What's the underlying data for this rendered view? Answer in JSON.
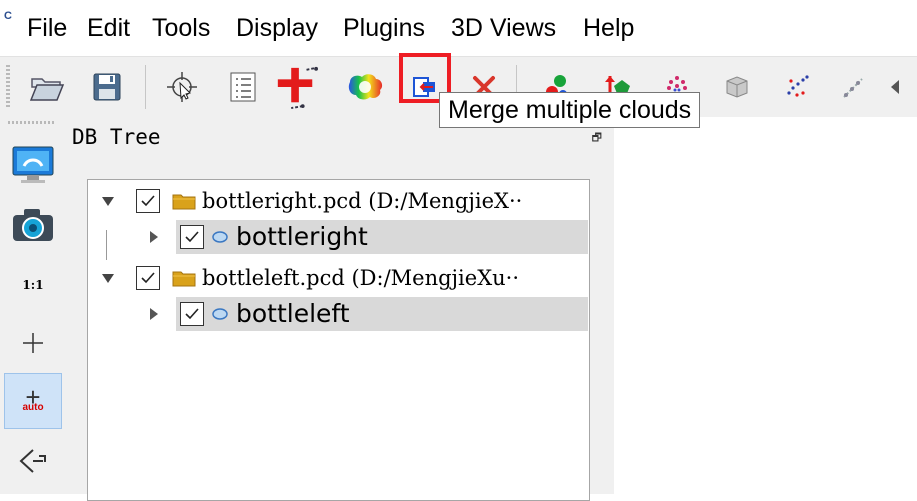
{
  "menu": {
    "items": [
      "File",
      "Edit",
      "Tools",
      "Display",
      "Plugins",
      "3D Views",
      "Help"
    ]
  },
  "toolbar": {
    "buttons": [
      {
        "icon": "open-folder-icon"
      },
      {
        "icon": "save-floppy-icon"
      },
      {
        "icon": "pointer-target-icon"
      },
      {
        "icon": "list-properties-icon"
      },
      {
        "icon": "translate-rotate-icon"
      },
      {
        "icon": "color-scalar-cloud-icon"
      },
      {
        "icon": "merge-clouds-icon"
      },
      {
        "icon": "delete-x-icon"
      },
      {
        "icon": "registration-icon"
      },
      {
        "icon": "align-points-icon"
      },
      {
        "icon": "sample-points-icon"
      },
      {
        "icon": "mesh-icon"
      },
      {
        "icon": "noise-filter-icon"
      },
      {
        "icon": "scatter-icon"
      }
    ],
    "tooltip": "Merge multiple clouds",
    "highlight_color": "#ee1d24"
  },
  "left_toolbar": {
    "one_to_one_label": "1:1",
    "auto_label": "auto"
  },
  "db_tree": {
    "title": "DB Tree",
    "items": [
      {
        "label": "bottleright.pcd (D:/MengjieX··",
        "child": "bottleright"
      },
      {
        "label": "bottleleft.pcd (D:/MengjieXu··",
        "child": "bottleleft"
      }
    ],
    "folder_color": "#d9a21b",
    "selection_color": "#d9d9d9"
  }
}
